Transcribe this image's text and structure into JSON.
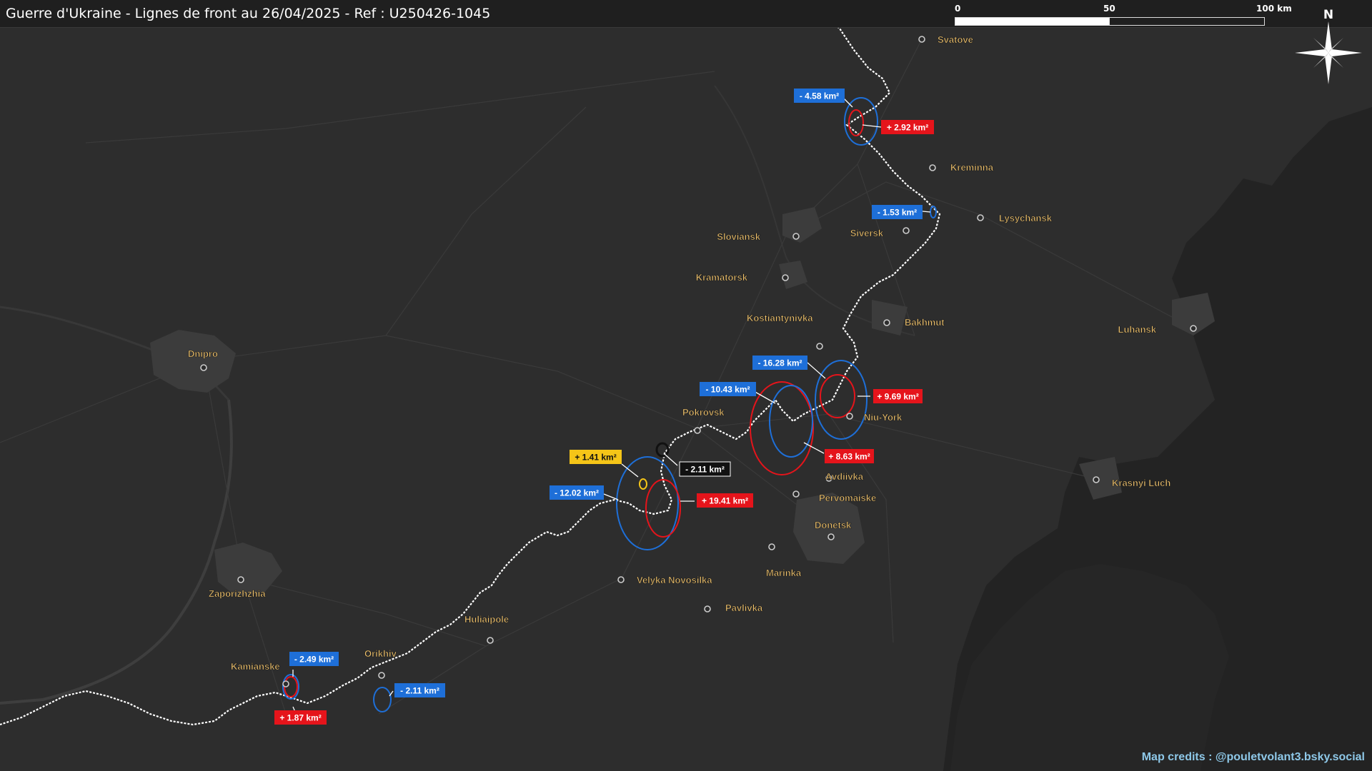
{
  "header": {
    "title": "Guerre d'Ukraine - Lignes de front au 26/04/2025 - Ref : U250426-1045"
  },
  "scale_bar": {
    "labels": [
      "0",
      "50",
      "100 km"
    ]
  },
  "compass": {
    "north_label": "N"
  },
  "credits": "Map credits : @pouletvolant3.bsky.social",
  "colors": {
    "background": "#2d2d2d",
    "city_label": "#f2c46d",
    "loss_box": "#1e6fd8",
    "gain_box": "#e5141b",
    "neutral_box": "#111111",
    "other_box": "#f5c518",
    "front_line": "#ffffff"
  },
  "cities": [
    {
      "name": "Svatove"
    },
    {
      "name": "Kreminna"
    },
    {
      "name": "Lysychansk"
    },
    {
      "name": "Siversk"
    },
    {
      "name": "Sloviansk"
    },
    {
      "name": "Kramatorsk"
    },
    {
      "name": "Kostiantynivka"
    },
    {
      "name": "Bakhmut"
    },
    {
      "name": "Luhansk"
    },
    {
      "name": "Niu-York"
    },
    {
      "name": "Pokrovsk"
    },
    {
      "name": "Avdiivka"
    },
    {
      "name": "Pervomaiske"
    },
    {
      "name": "Donetsk"
    },
    {
      "name": "Marinka"
    },
    {
      "name": "Krasnyi Luch"
    },
    {
      "name": "Velyka Novosilka"
    },
    {
      "name": "Pavlivka"
    },
    {
      "name": "Huliaipole"
    },
    {
      "name": "Orikhiv"
    },
    {
      "name": "Kamianske"
    },
    {
      "name": "Zaporizhzhia"
    },
    {
      "name": "Dnipro"
    }
  ],
  "changes": [
    {
      "label": "- 4.58 km²",
      "kind": "loss"
    },
    {
      "label": "+ 2.92 km²",
      "kind": "gain"
    },
    {
      "label": "- 1.53 km²",
      "kind": "loss"
    },
    {
      "label": "- 16.28 km²",
      "kind": "loss"
    },
    {
      "label": "- 10.43 km²",
      "kind": "loss"
    },
    {
      "label": "+ 9.69 km²",
      "kind": "gain"
    },
    {
      "label": "+ 8.63 km²",
      "kind": "gain"
    },
    {
      "label": "+ 1.41 km²",
      "kind": "other"
    },
    {
      "label": "- 2.11 km²",
      "kind": "neutral"
    },
    {
      "label": "- 12.02 km²",
      "kind": "loss"
    },
    {
      "label": "+ 19.41 km²",
      "kind": "gain"
    },
    {
      "label": "- 2.49 km²",
      "kind": "loss"
    },
    {
      "label": "+ 1.87 km²",
      "kind": "gain"
    },
    {
      "label": "- 2.11 km²",
      "kind": "loss"
    }
  ]
}
